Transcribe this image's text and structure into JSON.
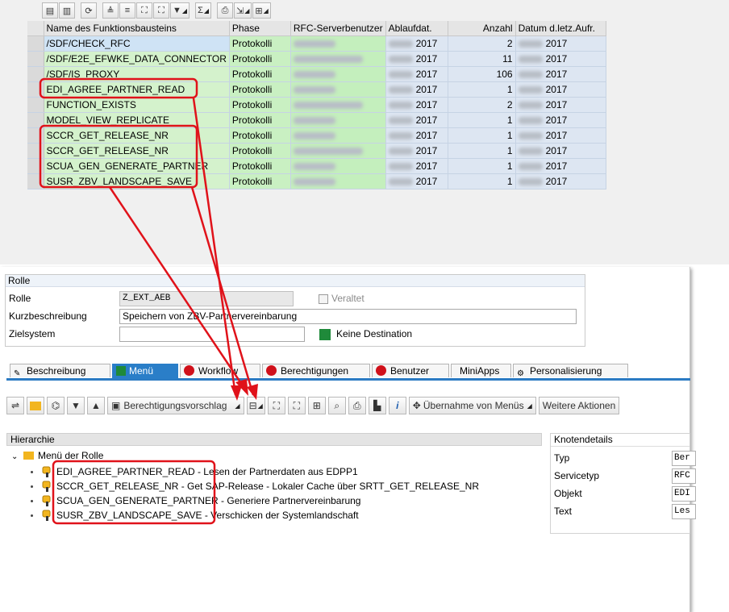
{
  "top_toolbar": {
    "icons": [
      "details-icon",
      "choose-detail-icon",
      "refresh-icon",
      "sort-ascending-icon",
      "sort-descending-icon",
      "find-icon",
      "find-next-icon",
      "filter-icon",
      "sum-icon",
      "print-icon",
      "export-icon",
      "layout-icon"
    ]
  },
  "alv": {
    "headers": [
      "Name des Funktionsbausteins",
      "Phase",
      "RFC-Serverbenutzer",
      "Ablaufdat.",
      "Anzahl",
      "Datum d.letz.Aufr."
    ],
    "rows": [
      {
        "name": "/SDF/CHECK_RFC",
        "phase": "Protokolli",
        "year1": "2017",
        "count": "2",
        "year2": "2017"
      },
      {
        "name": "/SDF/E2E_EFWKE_DATA_CONNECTOR",
        "phase": "Protokolli",
        "year1": "2017",
        "count": "11",
        "year2": "2017"
      },
      {
        "name": "/SDF/IS_PROXY",
        "phase": "Protokolli",
        "year1": "2017",
        "count": "106",
        "year2": "2017"
      },
      {
        "name": "EDI_AGREE_PARTNER_READ",
        "phase": "Protokolli",
        "year1": "2017",
        "count": "1",
        "year2": "2017"
      },
      {
        "name": "FUNCTION_EXISTS",
        "phase": "Protokolli",
        "year1": "2017",
        "count": "2",
        "year2": "2017"
      },
      {
        "name": "MODEL_VIEW_REPLICATE",
        "phase": "Protokolli",
        "year1": "2017",
        "count": "1",
        "year2": "2017"
      },
      {
        "name": "SCCR_GET_RELEASE_NR",
        "phase": "Protokolli",
        "year1": "2017",
        "count": "1",
        "year2": "2017"
      },
      {
        "name": "SCCR_GET_RELEASE_NR",
        "phase": "Protokolli",
        "year1": "2017",
        "count": "1",
        "year2": "2017"
      },
      {
        "name": "SCUA_GEN_GENERATE_PARTNER",
        "phase": "Protokolli",
        "year1": "2017",
        "count": "1",
        "year2": "2017"
      },
      {
        "name": "SUSR_ZBV_LANDSCAPE_SAVE",
        "phase": "Protokolli",
        "year1": "2017",
        "count": "1",
        "year2": "2017"
      }
    ]
  },
  "role": {
    "group_title": "Rolle",
    "role_label": "Rolle",
    "role_value": "Z_EXT_AEB",
    "obsolete_label": "Veraltet",
    "short_desc_label": "Kurzbeschreibung",
    "short_desc_value": "Speichern von ZBV-Partnervereinbarung",
    "target_system_label": "Zielsystem",
    "target_system_value": "",
    "destination_label": "Keine Destination"
  },
  "tabs": [
    "Beschreibung",
    "Menü",
    "Workflow",
    "Berechtigungen",
    "Benutzer",
    "MiniApps",
    "Personalisierung"
  ],
  "active_tab": "Menü",
  "menu_toolbar": {
    "auth_proposal": "Berechtigungsvorschlag",
    "take_menus": "Übernahme von Menüs",
    "more_actions": "Weitere Aktionen"
  },
  "hierarchy": {
    "title": "Hierarchie",
    "root": "Menü der Rolle",
    "items": [
      "EDI_AGREE_PARTNER_READ - Lesen der Partnerdaten aus EDPP1",
      "SCCR_GET_RELEASE_NR - Get SAP-Release - Lokaler Cache über SRTT_GET_RELEASE_NR",
      "SCUA_GEN_GENERATE_PARTNER - Generiere Partnervereinbarung",
      "SUSR_ZBV_LANDSCAPE_SAVE - Verschicken der Systemlandschaft"
    ]
  },
  "node_details": {
    "title": "Knotendetails",
    "rows": [
      {
        "label": "Typ",
        "value": "Ber"
      },
      {
        "label": "Servicetyp",
        "value": "RFC"
      },
      {
        "label": "Objekt",
        "value": "EDI"
      },
      {
        "label": "Text",
        "value": "Les"
      }
    ]
  },
  "colors": {
    "annotation": "#e0121a",
    "tab_active": "#2a7ec8",
    "status_red": "#d0101a",
    "status_green": "#1f8a3a"
  }
}
